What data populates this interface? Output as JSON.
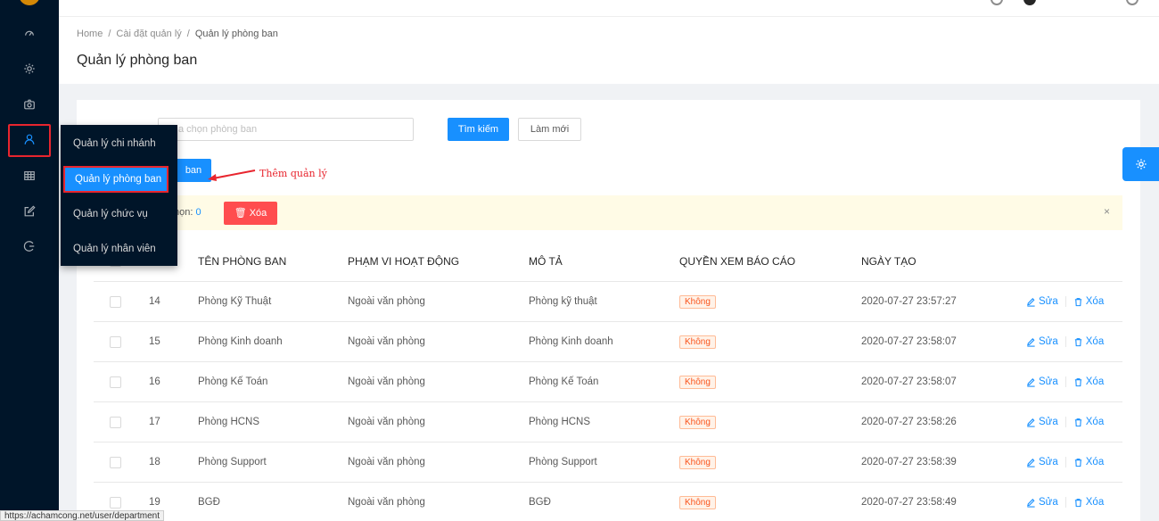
{
  "breadcrumb": {
    "home": "Home",
    "settings": "Cài đặt quản lý",
    "current": "Quản lý phòng ban",
    "sep": "/"
  },
  "page_title": "Quản lý phòng ban",
  "sidebar": {
    "icons": [
      "dashboard-icon",
      "settings-icon",
      "camera-icon",
      "user-icon",
      "table-icon",
      "edit-icon",
      "logout-icon"
    ]
  },
  "filter": {
    "placeholder": "a chọn phòng ban",
    "search_label": "Tìm kiếm",
    "reset_label": "Làm mới",
    "add_label": "ban"
  },
  "annotation": "Thêm quản lý",
  "selection": {
    "label": "họn:",
    "count": "0",
    "delete_label": "Xóa",
    "close": "×"
  },
  "flyout": {
    "items": [
      {
        "label": "Quản lý chi nhánh"
      },
      {
        "label": "Quản lý phòng ban"
      },
      {
        "label": "Quản lý chức vụ"
      },
      {
        "label": "Quản lý nhân viên"
      }
    ]
  },
  "table": {
    "headers": {
      "name": "TÊN PHÒNG BAN",
      "scope": "PHẠM VI HOẠT ĐỘNG",
      "desc": "MÔ TẢ",
      "perm": "QUYỀN XEM BÁO CÁO",
      "date": "NGÀY TẠO"
    },
    "edit_label": "Sửa",
    "delete_label": "Xóa",
    "rows": [
      {
        "id": "14",
        "name": "Phòng Kỹ Thuật",
        "scope": "Ngoài văn phòng",
        "desc": "Phòng kỹ thuật",
        "perm": "Không",
        "date": "2020-07-27 23:57:27"
      },
      {
        "id": "15",
        "name": "Phòng Kinh doanh",
        "scope": "Ngoài văn phòng",
        "desc": "Phòng Kinh doanh",
        "perm": "Không",
        "date": "2020-07-27 23:58:07"
      },
      {
        "id": "16",
        "name": "Phòng Kế Toán",
        "scope": "Ngoài văn phòng",
        "desc": "Phòng Kế Toán",
        "perm": "Không",
        "date": "2020-07-27 23:58:07"
      },
      {
        "id": "17",
        "name": "Phòng HCNS",
        "scope": "Ngoài văn phòng",
        "desc": "Phòng HCNS",
        "perm": "Không",
        "date": "2020-07-27 23:58:26"
      },
      {
        "id": "18",
        "name": "Phòng Support",
        "scope": "Ngoài văn phòng",
        "desc": "Phòng Support",
        "perm": "Không",
        "date": "2020-07-27 23:58:39"
      },
      {
        "id": "19",
        "name": "BGĐ",
        "scope": "Ngoài văn phòng",
        "desc": "BGĐ",
        "perm": "Không",
        "date": "2020-07-27 23:58:49"
      }
    ]
  },
  "status_url": "https://achamcong.net/user/department",
  "colors": {
    "primary": "#1890ff",
    "sidebar": "#001529",
    "danger": "#ff4d4f",
    "highlight": "#e8252e"
  }
}
